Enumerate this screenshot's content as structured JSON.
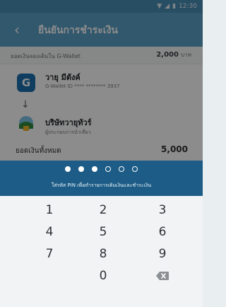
{
  "status": {
    "time": "12:30"
  },
  "app_bar": {
    "title": "ยืนยันการชำระเงิน"
  },
  "payment": {
    "amount_label": "ยอดเงินจองเติมใน G-Wallet",
    "amount_value": "2,000",
    "amount_unit": "บาท",
    "from_logo_text": "G",
    "from_name": "วายุ มีตังค์",
    "from_id": "G-Wallet ID **** ******** 3937",
    "to_name": "บริษัทวายุทัวร์",
    "to_desc": "ผู้ประกอบการนำเที่ยว",
    "partial_label": "ยอดเงินทั้งหมด",
    "partial_value": "5,000"
  },
  "pin": {
    "entered": 3,
    "length": 6,
    "hint": "ใส่รหัส PIN เพื่อทำรายการเติมเงินและชำระเงิน"
  },
  "keypad": {
    "keys": [
      "1",
      "2",
      "3",
      "4",
      "5",
      "6",
      "7",
      "8",
      "9",
      "0"
    ]
  },
  "colors": {
    "primary": "#5aa0c6",
    "pin_panel": "#1d5c86",
    "wallet_logo": "#1a6fb0"
  }
}
